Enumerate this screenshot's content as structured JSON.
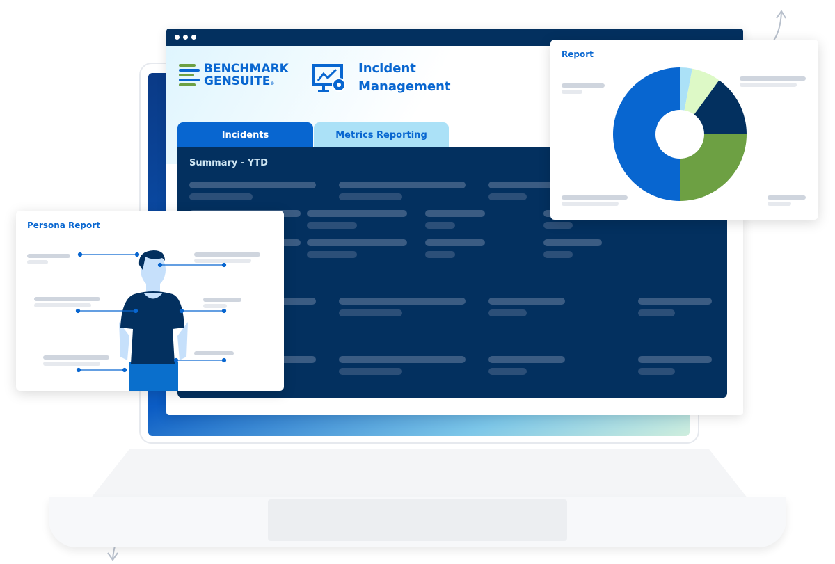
{
  "window": {
    "controls": [
      "dot",
      "dot",
      "dot"
    ]
  },
  "brand": {
    "line1": "BENCHMARK",
    "line2": "GENSUITE",
    "registered": "®",
    "logo_colors": [
      "#0866d0",
      "#6da043"
    ]
  },
  "app": {
    "title_line1": "Incident",
    "title_line2": "Management",
    "icon": "monitor-chart-gear-icon"
  },
  "tabs": [
    {
      "label": "Incidents",
      "active": true
    },
    {
      "label": "Metrics Reporting",
      "active": false
    }
  ],
  "panel": {
    "heading": "Summary - YTD"
  },
  "report_card": {
    "title": "Report"
  },
  "persona_card": {
    "title": "Persona Report"
  },
  "colors": {
    "navy": "#03305f",
    "blue": "#0866d0",
    "light_blue": "#abe1f7",
    "green": "#6da043",
    "light_green": "#ddf9c6"
  },
  "chart_data": {
    "type": "pie",
    "donut": true,
    "values": [
      3,
      7,
      15,
      25,
      50
    ],
    "colors": [
      "#abe1f7",
      "#ddf9c6",
      "#03305f",
      "#6da043",
      "#0866d0"
    ]
  }
}
